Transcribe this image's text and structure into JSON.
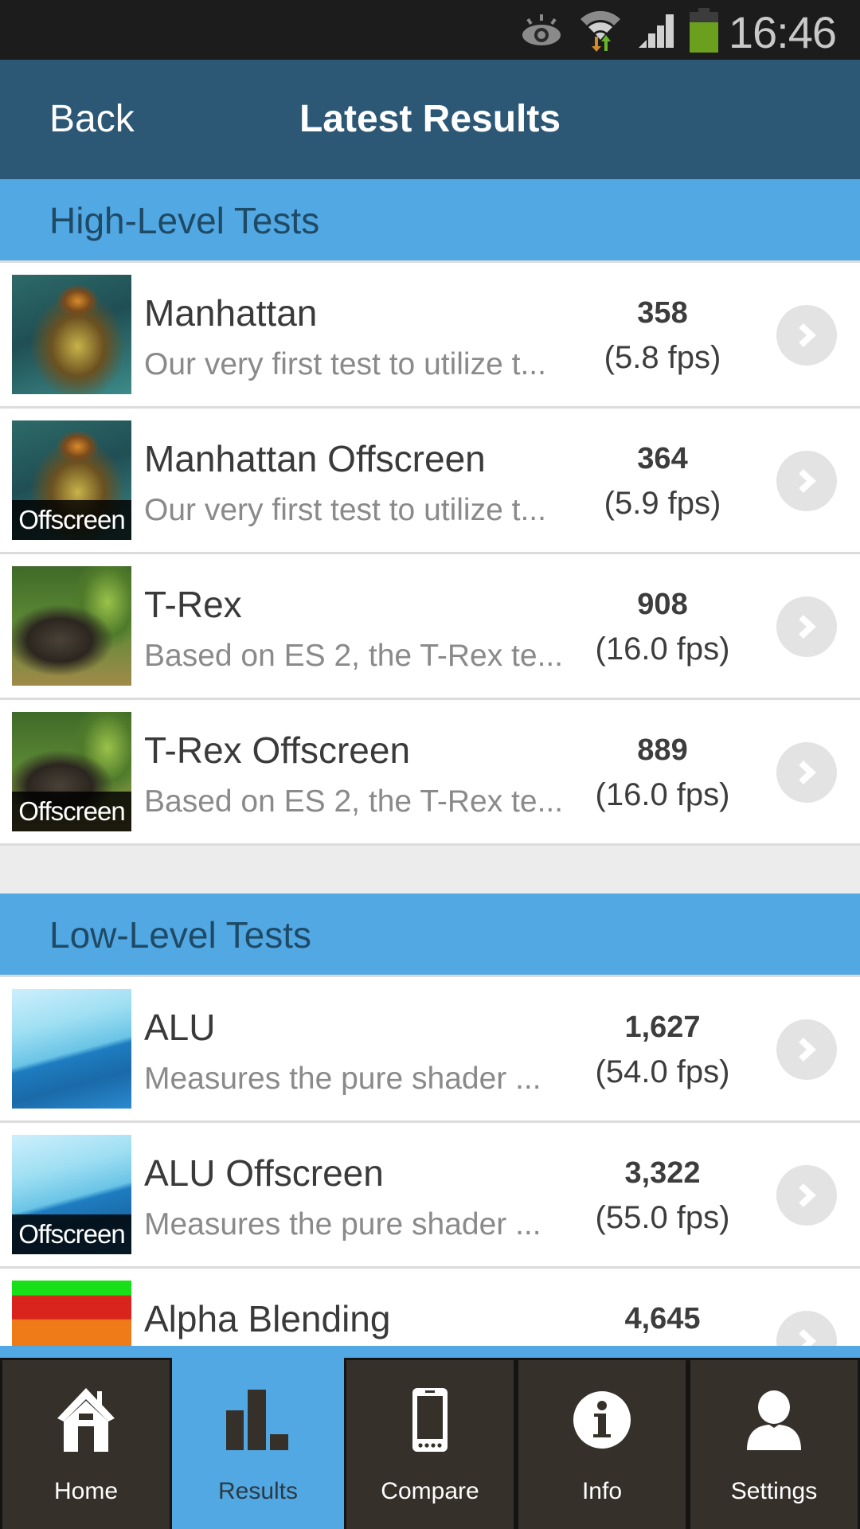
{
  "status_bar": {
    "time": "16:46",
    "icons": [
      "eye-icon",
      "wifi-icon",
      "signal-icon",
      "battery-icon"
    ],
    "battery_color": "#6aa01e"
  },
  "header": {
    "back_label": "Back",
    "title": "Latest Results"
  },
  "colors": {
    "header_bg": "#2c5876",
    "section_bg": "#52a8e2",
    "nav_bg": "#35302a",
    "nav_active_bg": "#52a8e2"
  },
  "sections": [
    {
      "title": "High-Level Tests",
      "items": [
        {
          "name": "Manhattan",
          "description": "Our very first test to utilize t...",
          "score": "358",
          "fps": "(5.8 fps)",
          "thumbnail": "manhattan",
          "offscreen": false
        },
        {
          "name": "Manhattan Offscreen",
          "description": "Our very first test to utilize t...",
          "score": "364",
          "fps": "(5.9 fps)",
          "thumbnail": "manhattan",
          "offscreen": true,
          "offscreen_label": "Offscreen"
        },
        {
          "name": "T-Rex",
          "description": "Based on ES 2, the T-Rex te...",
          "score": "908",
          "fps": "(16.0 fps)",
          "thumbnail": "trex",
          "offscreen": false
        },
        {
          "name": "T-Rex Offscreen",
          "description": "Based on ES 2, the T-Rex te...",
          "score": "889",
          "fps": "(16.0 fps)",
          "thumbnail": "trex",
          "offscreen": true,
          "offscreen_label": "Offscreen"
        }
      ]
    },
    {
      "title": "Low-Level Tests",
      "items": [
        {
          "name": "ALU",
          "description": "Measures the pure shader ...",
          "score": "1,627",
          "fps": "(54.0 fps)",
          "thumbnail": "alu",
          "offscreen": false
        },
        {
          "name": "ALU Offscreen",
          "description": "Measures the pure shader ...",
          "score": "3,322",
          "fps": "(55.0 fps)",
          "thumbnail": "alu",
          "offscreen": true,
          "offscreen_label": "Offscreen"
        },
        {
          "name": "Alpha Blending",
          "description": "",
          "score": "4,645",
          "fps": "",
          "thumbnail": "alpha",
          "offscreen": false
        }
      ]
    }
  ],
  "bottom_nav": {
    "active": "Results",
    "tabs": [
      {
        "label": "Home",
        "icon": "home-icon"
      },
      {
        "label": "Results",
        "icon": "bar-chart-icon"
      },
      {
        "label": "Compare",
        "icon": "phone-icon"
      },
      {
        "label": "Info",
        "icon": "info-icon"
      },
      {
        "label": "Settings",
        "icon": "user-icon"
      }
    ]
  }
}
